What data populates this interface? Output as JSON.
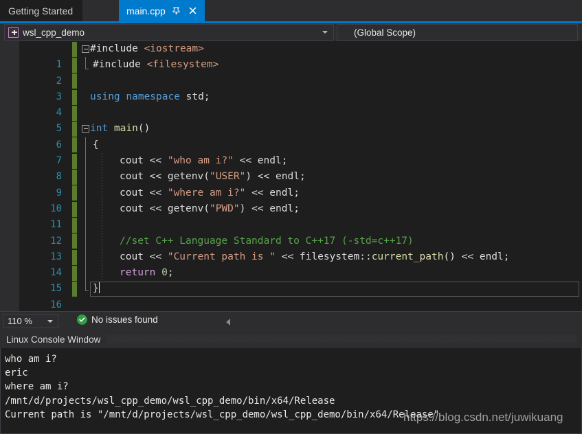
{
  "tabs": [
    {
      "label": "Getting Started",
      "active": false,
      "name": "tab-getting-started"
    },
    {
      "label": "main.cpp",
      "active": true,
      "name": "tab-main-cpp",
      "pin_icon": "pin-icon",
      "close_icon": "close-icon"
    }
  ],
  "navbar": {
    "project_icon": "cpp-project-icon",
    "project": "wsl_cpp_demo",
    "scope": "(Global Scope)",
    "dropdown_icon": "chevron-down-icon"
  },
  "editor": {
    "lines": [
      {
        "n": "1",
        "fold": "collapse-icon"
      },
      {
        "n": "2"
      },
      {
        "n": "3"
      },
      {
        "n": "4"
      },
      {
        "n": "5"
      },
      {
        "n": "6",
        "fold": "collapse-icon"
      },
      {
        "n": "7"
      },
      {
        "n": "8"
      },
      {
        "n": "9"
      },
      {
        "n": "10"
      },
      {
        "n": "11"
      },
      {
        "n": "12"
      },
      {
        "n": "13"
      },
      {
        "n": "14"
      },
      {
        "n": "15"
      },
      {
        "n": "16"
      }
    ],
    "code": {
      "l1_pp": "#include",
      "l1_inc": " <iostream>",
      "l2_pp": "#include",
      "l2_inc": " <filesystem>",
      "l4_kw": "using namespace",
      "l4_id": " std",
      "l4_p": ";",
      "l6_kw": "int",
      "l6_fn": " main",
      "l6_p": "()",
      "l7_p": "{",
      "l8_id": "cout",
      "l8_op": " << ",
      "l8_str": "\"who am i?\"",
      "l8_op2": " << ",
      "l8_id2": "endl",
      "l8_p": ";",
      "l9_id": "cout",
      "l9_op": " << ",
      "l9_id2": "getenv",
      "l9_p1": "(",
      "l9_str": "\"USER\"",
      "l9_p2": ")",
      "l9_op2": " << ",
      "l9_id3": "endl",
      "l9_p3": ";",
      "l10_id": "cout",
      "l10_op": " << ",
      "l10_str": "\"where am i?\"",
      "l10_op2": " << ",
      "l10_id2": "endl",
      "l10_p": ";",
      "l11_id": "cout",
      "l11_op": " << ",
      "l11_id2": "getenv",
      "l11_p1": "(",
      "l11_str": "\"PWD\"",
      "l11_p2": ")",
      "l11_op2": " << ",
      "l11_id3": "endl",
      "l11_p3": ";",
      "l13_cmt": "//set C++ Language Standard to C++17 (-std=c++17)",
      "l14_id": "cout",
      "l14_op": " << ",
      "l14_str": "\"Current path is \"",
      "l14_op2": " << ",
      "l14_id2": "filesystem",
      "l14_p1": "::",
      "l14_fn": "current_path",
      "l14_p2": "()",
      "l14_op3": " << ",
      "l14_id3": "endl",
      "l14_p3": ";",
      "l15_ctl": "return",
      "l15_num": " 0",
      "l15_p": ";",
      "l16_p": "}"
    }
  },
  "statusbar": {
    "zoom": "110 %",
    "zoom_arrow_icon": "chevron-down-icon",
    "status_icon": "check-circle-icon",
    "status_text": "No issues found",
    "prev_issue_icon": "arrow-left-icon"
  },
  "console": {
    "title": "Linux Console Window",
    "lines": [
      "who am i?",
      "eric",
      "where am i?",
      "/mnt/d/projects/wsl_cpp_demo/wsl_cpp_demo/bin/x64/Release",
      "Current path is \"/mnt/d/projects/wsl_cpp_demo/wsl_cpp_demo/bin/x64/Release\""
    ]
  },
  "watermark": "https://blog.csdn.net/juwikuang",
  "colors": {
    "accent": "#007acc",
    "chrome": "#2d2d30",
    "editor_bg": "#1e1e1e",
    "line_number": "#2b91af",
    "change_bar": "#5b7c2e",
    "comment": "#57a64a",
    "string": "#d69d85",
    "keyword": "#569cd6",
    "function": "#dcdcaa",
    "control": "#d8a0df",
    "status_ok": "#2ea043"
  }
}
